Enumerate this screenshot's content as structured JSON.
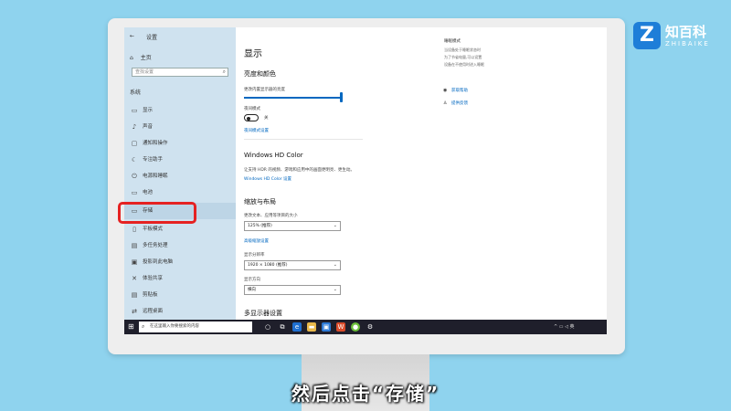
{
  "logo": {
    "name": "知百科",
    "sub": "ZHIBAIKE",
    "mark": "Z"
  },
  "caption": "然后点击“存储”",
  "window": {
    "title": "设置",
    "back": "←"
  },
  "sidebar": {
    "home": "主页",
    "search_placeholder": "查找设置",
    "section": "系统",
    "items": [
      {
        "icon": "display-icon",
        "glyph": "▭",
        "label": "显示"
      },
      {
        "icon": "sound-icon",
        "glyph": "♪",
        "label": "声音"
      },
      {
        "icon": "notifications-icon",
        "glyph": "▢",
        "label": "通知和操作"
      },
      {
        "icon": "focus-assist-icon",
        "glyph": "☾",
        "label": "专注助手"
      },
      {
        "icon": "power-sleep-icon",
        "glyph": "⏻",
        "label": "电源和睡眠"
      },
      {
        "icon": "battery-icon",
        "glyph": "▭",
        "label": "电池"
      },
      {
        "icon": "storage-icon",
        "glyph": "▭",
        "label": "存储"
      },
      {
        "icon": "tablet-icon",
        "glyph": "▯",
        "label": "平板模式"
      },
      {
        "icon": "multitasking-icon",
        "glyph": "▤",
        "label": "多任务处理"
      },
      {
        "icon": "projecting-icon",
        "glyph": "▣",
        "label": "投影到此电脑"
      },
      {
        "icon": "shared-experiences-icon",
        "glyph": "✕",
        "label": "体验共享"
      },
      {
        "icon": "clipboard-icon",
        "glyph": "▤",
        "label": "剪贴板"
      },
      {
        "icon": "remote-desktop-icon",
        "glyph": "⇄",
        "label": "远程桌面"
      }
    ],
    "selected_index": 6
  },
  "main": {
    "title": "显示",
    "brightness_heading": "亮度和颜色",
    "brightness_label": "更改内置显示器的亮度",
    "brightness_level": 1.0,
    "night_light_label": "夜间模式",
    "night_light_state": "关",
    "night_light_link": "夜间模式设置",
    "hd_color_heading": "Windows HD Color",
    "hd_color_desc": "让支持 HDR 的视频、游戏和应用中的画面更明亮、更生动。",
    "hd_color_link": "Windows HD Color 设置",
    "scale_heading": "缩放与布局",
    "scale_label": "更改文本、应用等项目的大小",
    "scale_value": "125% (推荐)",
    "advanced_scale_link": "高级缩放设置",
    "resolution_label": "显示分辨率",
    "resolution_value": "1920 × 1080 (推荐)",
    "orientation_label": "显示方向",
    "orientation_value": "横向",
    "multi_display_heading": "多显示器设置"
  },
  "right": {
    "title": "睡眠模式",
    "lines": [
      "当设备处于睡眠状态时",
      "为了节省电量,可以设置",
      "设备在不使用时进入睡眠"
    ],
    "link1": "获取帮助",
    "link2": "提供反馈"
  },
  "taskbar": {
    "search_text": "在这里输入你要搜索的内容",
    "tray": "^ ▭ ◁ 英"
  }
}
